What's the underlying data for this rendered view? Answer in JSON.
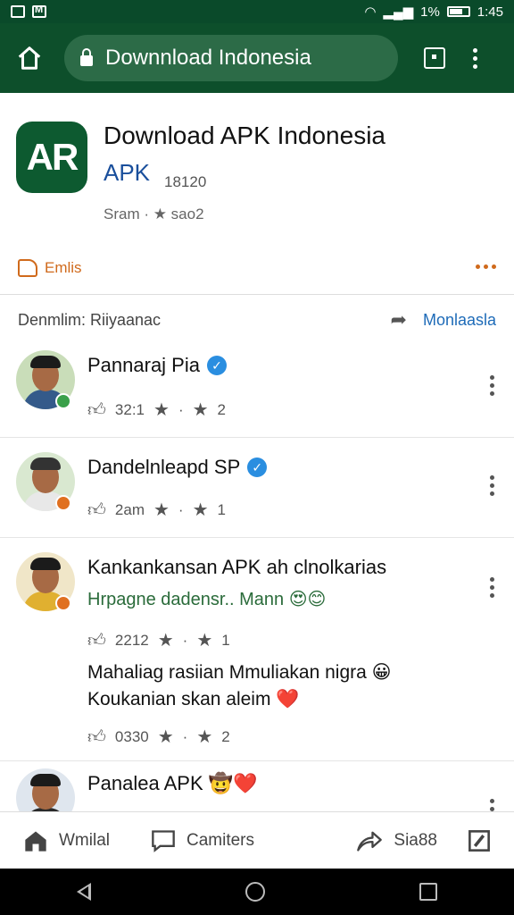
{
  "status_bar": {
    "battery": "1%",
    "time": "1:45"
  },
  "toolbar": {
    "url_title": "Downnload Indonesia"
  },
  "app": {
    "icon_text": "AR",
    "title": "Download APK Indonesia",
    "subtitle": "APK",
    "count": "18120",
    "meta": "Sram · ★ sao2",
    "tag_label": "Emlis"
  },
  "section": {
    "header": "Denmlim: Riiyaanac",
    "share_label": "Monlaasla"
  },
  "comments": [
    {
      "name": "Pannaraj Pia",
      "verified": true,
      "likes": "32:1",
      "rating": "2"
    },
    {
      "name": "Dandelnleapd SP",
      "verified": true,
      "likes": "2am",
      "rating": "1"
    },
    {
      "name": "Kankankansan APK ah clnolkarias",
      "verified": false,
      "sub": "Hrpagne dadensr.. Mann 😍😊",
      "likes": "2212",
      "rating": "1",
      "text": "Mahaliag rasiian Mmuliakan nigra 😀 Koukanian skan aleim ❤️",
      "likes2": "0330",
      "rating2": "2"
    },
    {
      "name": "Panalea APK 🤠❤️",
      "verified": false
    }
  ],
  "bottom_nav": {
    "home_label": "Wmilal",
    "comments_label": "Camiters",
    "share_label": "Sia88"
  },
  "colors": {
    "toolbar": "#0d4f2b",
    "accent": "#d06a1c",
    "link": "#1e6bb8"
  }
}
